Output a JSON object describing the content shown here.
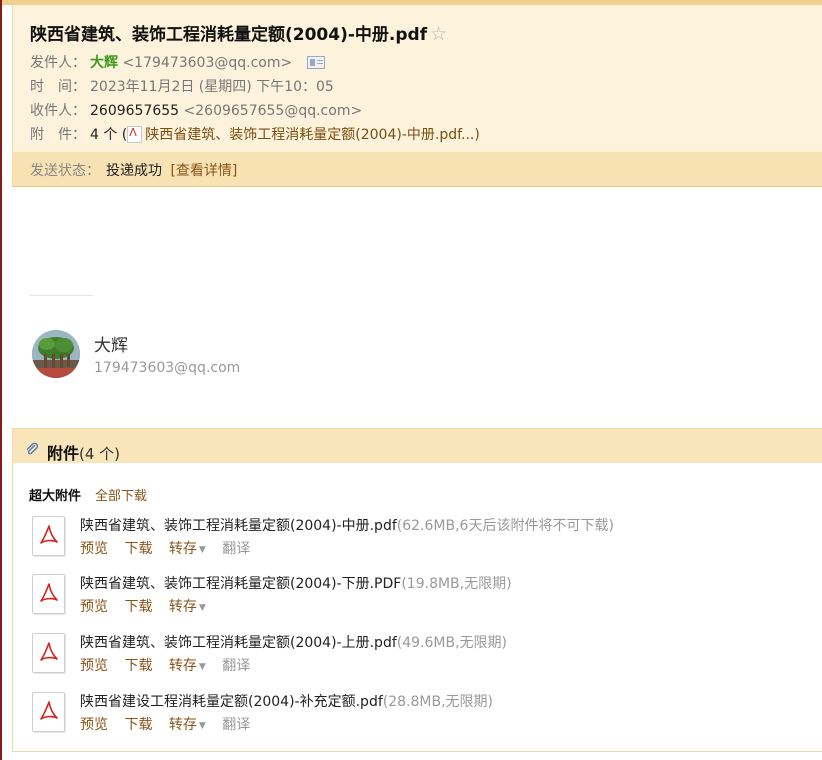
{
  "email": {
    "subject": "陕西省建筑、装饰工程消耗量定额(2004)-中册.pdf",
    "from_label": "发件人：",
    "from_name": "大辉",
    "from_email": "<179473603@qq.com>",
    "time_label": "时　间：",
    "time_value": "2023年11月2日 (星期四) 下午10：05",
    "to_label": "收件人：",
    "to_name": "2609657655",
    "to_email": "<2609657655@qq.com>",
    "attach_label": "附　件：",
    "attach_count": "4 个 (",
    "attach_first": "陕西省建筑、装饰工程消耗量定额(2004)-中册.pdf...)"
  },
  "status": {
    "label": "发送状态：",
    "value": "投递成功",
    "detail_link": "[查看详情]"
  },
  "signature": {
    "name": "大辉",
    "email": "179473603@qq.com"
  },
  "attachments": {
    "title": "附件",
    "count": "(4 个)",
    "group_label": "超大附件",
    "download_all": "全部下载",
    "actions": {
      "preview": "预览",
      "download": "下载",
      "save": "转存",
      "translate": "翻译"
    },
    "items": [
      {
        "name": "陕西省建筑、装饰工程消耗量定额(2004)-中册.pdf",
        "meta": "(62.6MB,6天后该附件将不可下载)"
      },
      {
        "name": "陕西省建筑、装饰工程消耗量定额(2004)-下册.PDF",
        "meta": "(19.8MB,无限期)"
      },
      {
        "name": "陕西省建筑、装饰工程消耗量定额(2004)-上册.pdf",
        "meta": "(49.6MB,无限期)"
      },
      {
        "name": "陕西省建设工程消耗量定额(2004)-补充定额.pdf",
        "meta": "(28.8MB,无限期)"
      }
    ]
  }
}
